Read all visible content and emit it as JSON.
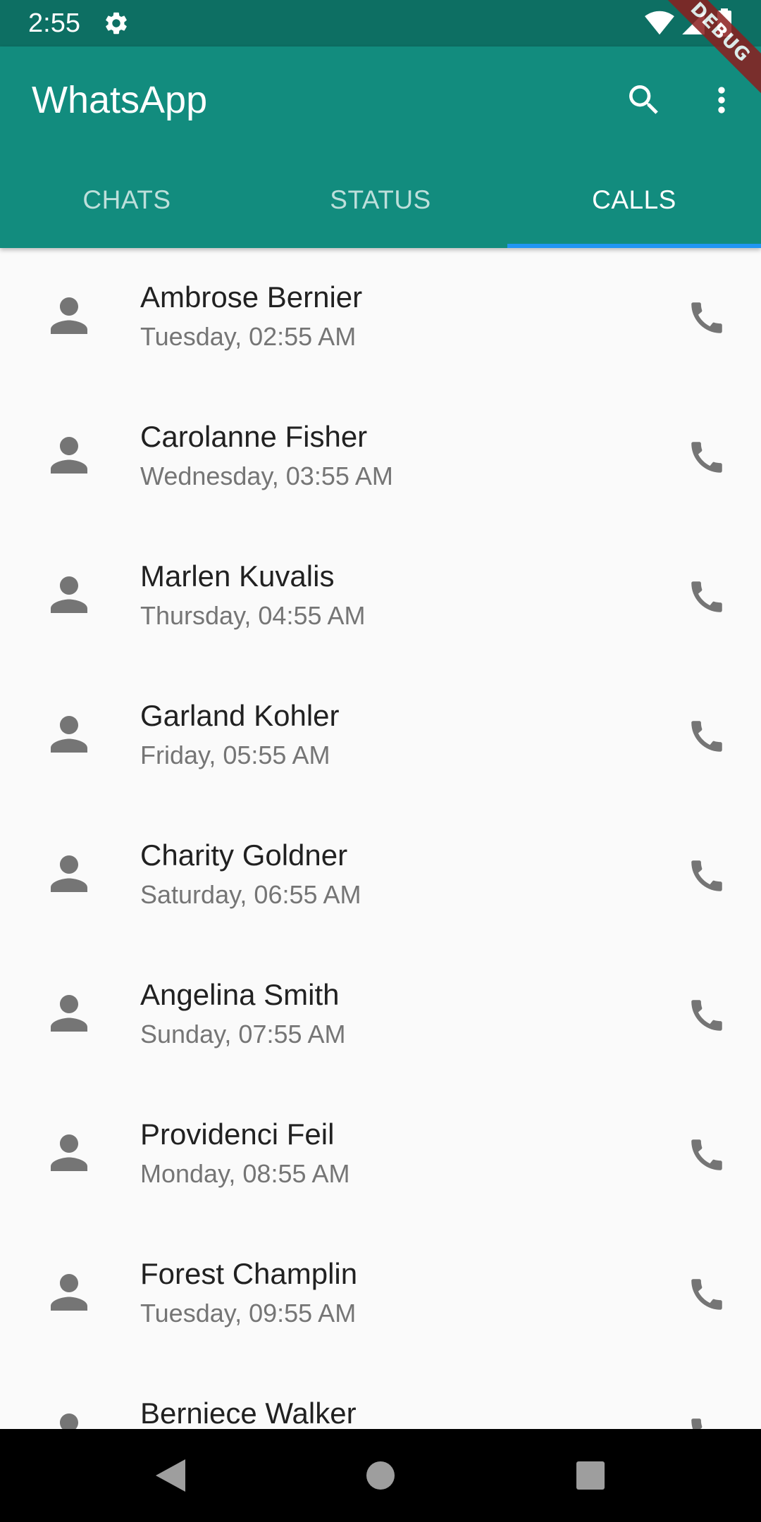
{
  "status_bar": {
    "time": "2:55",
    "icons": [
      "gear-icon",
      "wifi-icon",
      "signal-icon",
      "battery-icon"
    ]
  },
  "debug_banner": "DEBUG",
  "app_bar": {
    "title": "WhatsApp",
    "actions": [
      "search-icon",
      "more-vert-icon"
    ],
    "background_color": "#128c7e"
  },
  "tabs": [
    {
      "label": "CHATS",
      "active": false
    },
    {
      "label": "STATUS",
      "active": false
    },
    {
      "label": "CALLS",
      "active": true
    }
  ],
  "calls": [
    {
      "name": "Ambrose Bernier",
      "time": "Tuesday, 02:55 AM"
    },
    {
      "name": "Carolanne Fisher",
      "time": "Wednesday, 03:55 AM"
    },
    {
      "name": "Marlen Kuvalis",
      "time": "Thursday, 04:55 AM"
    },
    {
      "name": "Garland Kohler",
      "time": "Friday, 05:55 AM"
    },
    {
      "name": "Charity Goldner",
      "time": "Saturday, 06:55 AM"
    },
    {
      "name": "Angelina Smith",
      "time": "Sunday, 07:55 AM"
    },
    {
      "name": "Providenci Feil",
      "time": "Monday, 08:55 AM"
    },
    {
      "name": "Forest Champlin",
      "time": "Tuesday, 09:55 AM"
    },
    {
      "name": "Berniece Walker",
      "time": ""
    }
  ],
  "colors": {
    "accent": "#2196f3",
    "status_bar": "#0d6f63",
    "icon_gray": "#757575"
  },
  "nav_bar": {
    "buttons": [
      "back-icon",
      "home-icon",
      "recents-icon"
    ]
  }
}
